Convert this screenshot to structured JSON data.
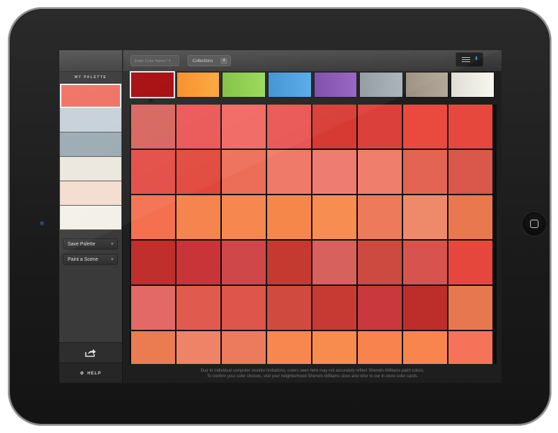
{
  "sidebar": {
    "palette_title": "MY PALETTE",
    "palette_swatches": [
      "#f06a5c",
      "#c4ced7",
      "#98a7b0",
      "#ebe7dd",
      "#f2dccd",
      "#f2f0e8"
    ],
    "save_palette_label": "Save Palette",
    "paint_scene_label": "Paint a Scene",
    "plus_glyph": "+",
    "share_icon": "share-icon",
    "help_label": "HELP",
    "help_icon": "gear-icon"
  },
  "topbar": {
    "search_placeholder": "Enter Color Name / #",
    "collections_label": "Collections",
    "collections_count": "4",
    "menu_icon": "list-menu-icon"
  },
  "families": [
    {
      "name": "red",
      "color": "#a30003"
    },
    {
      "name": "orange",
      "color": "#f58a1e"
    },
    {
      "name": "green",
      "color": "#7dbf3a"
    },
    {
      "name": "blue",
      "color": "#3a8fd0"
    },
    {
      "name": "purple",
      "color": "#7a48a8"
    },
    {
      "name": "gray-blue",
      "color": "#8f99a0"
    },
    {
      "name": "taupe",
      "color": "#9a8f80"
    },
    {
      "name": "white",
      "color": "#deddd6"
    }
  ],
  "grid": [
    [
      "#d6605a",
      "#ea5352",
      "#f06660",
      "#e85451",
      "#d63a32",
      "#dc403a",
      "#ea4a3e",
      "#e7483d"
    ],
    [
      "#e24a43",
      "#e1463a",
      "#ed6e58",
      "#ef7a6a",
      "#ef7c70",
      "#ef7e6c",
      "#e36452",
      "#d9574b"
    ],
    [
      "#f4704f",
      "#f5844e",
      "#f6884f",
      "#f6874b",
      "#f78d50",
      "#ed7a5a",
      "#ee8a6a",
      "#e9784f"
    ],
    [
      "#c12f2c",
      "#c93438",
      "#d0474a",
      "#c53a30",
      "#d7615d",
      "#cc4a40",
      "#d7534d",
      "#e6473d"
    ],
    [
      "#e26966",
      "#e05a4e",
      "#de554b",
      "#d14a3f",
      "#c73a33",
      "#c9383c",
      "#bd2e2b",
      "#e7774f"
    ],
    [
      "#eb7b51",
      "#ef8367",
      "#eb7b5c",
      "#f7874e",
      "#f88c4f",
      "#f8834f",
      "#f8854e",
      "#f57359"
    ]
  ],
  "disclaimer": {
    "line1": "Due to individual computer monitor limitations, colors seen here may not accurately reflect Sherwin-Williams paint colors.",
    "line2": "To confirm your color choices, visit your neighborhood Sherwin-Williams store and refer to our in-store color cards."
  }
}
